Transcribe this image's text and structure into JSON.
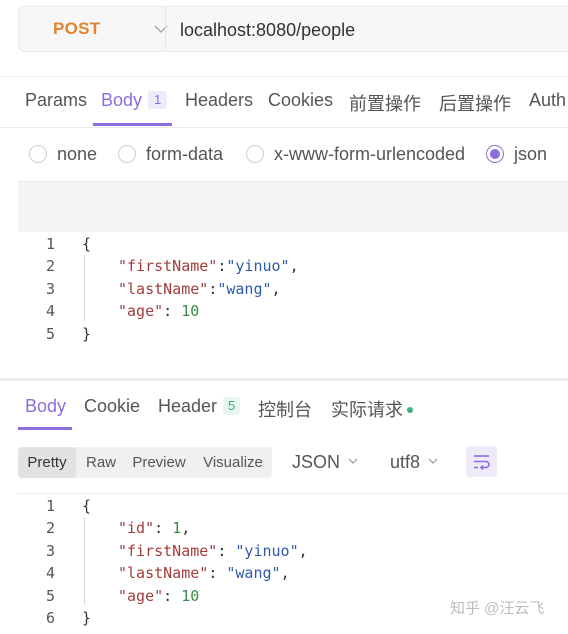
{
  "request": {
    "method": "POST",
    "url": "localhost:8080/people"
  },
  "request_tabs": {
    "params": "Params",
    "body": "Body",
    "body_badge": "1",
    "headers": "Headers",
    "cookies": "Cookies",
    "pre": "前置操作",
    "post": "后置操作",
    "auth": "Auth"
  },
  "body_types": {
    "none": "none",
    "form_data": "form-data",
    "urlencoded": "x-www-form-urlencoded",
    "json": "json",
    "selected": "json"
  },
  "request_body": {
    "line_numbers": [
      "1",
      "2",
      "3",
      "4",
      "5"
    ],
    "lines": {
      "l1": "{",
      "l2_key": "\"firstName\"",
      "l2_sep": ":",
      "l2_val": "\"yinuo\"",
      "l2_end": ",",
      "l3_key": "\"lastName\"",
      "l3_sep": ":",
      "l3_val": "\"wang\"",
      "l3_end": ",",
      "l4_key": "\"age\"",
      "l4_sep": ": ",
      "l4_val": "10",
      "l5": "}"
    }
  },
  "response_tabs": {
    "body": "Body",
    "cookie": "Cookie",
    "header": "Header",
    "header_badge": "5",
    "console": "控制台",
    "actual_request": "实际请求"
  },
  "response_view": {
    "pretty": "Pretty",
    "raw": "Raw",
    "preview": "Preview",
    "visualize": "Visualize",
    "active": "Pretty",
    "format": "JSON",
    "encoding": "utf8"
  },
  "response_body": {
    "line_numbers": [
      "1",
      "2",
      "3",
      "4",
      "5",
      "6"
    ],
    "lines": {
      "l1": "{",
      "l2_key": "\"id\"",
      "l2_sep": ": ",
      "l2_val": "1",
      "l2_end": ",",
      "l3_key": "\"firstName\"",
      "l3_sep": ": ",
      "l3_val": "\"yinuo\"",
      "l3_end": ",",
      "l4_key": "\"lastName\"",
      "l4_sep": ": ",
      "l4_val": "\"wang\"",
      "l4_end": ",",
      "l5_key": "\"age\"",
      "l5_sep": ": ",
      "l5_val": "10",
      "l6": "}"
    }
  },
  "watermark": "知乎 @汪云飞",
  "colors": {
    "accent": "#8b6ee0",
    "method": "#e0852e",
    "success": "#3bb27c",
    "json_key": "#a33d3d",
    "json_string": "#2f5aa8",
    "json_number": "#3a8a4a"
  },
  "icons": {
    "method_caret": "chevron-down-icon",
    "wrap": "wrap-lines-icon",
    "status_dot": "status-dot-icon"
  }
}
